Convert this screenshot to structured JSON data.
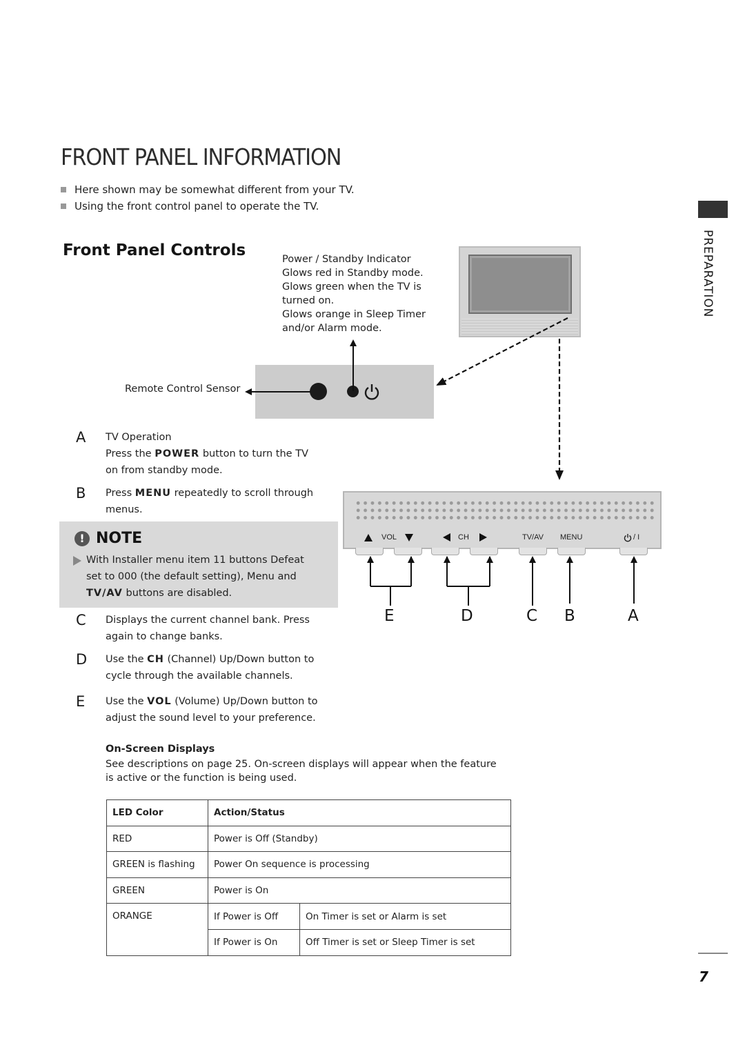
{
  "page": {
    "title": "FRONT PANEL INFORMATION",
    "bullets": [
      "Here shown may be somewhat different from your TV.",
      "Using the front control panel to operate the TV."
    ],
    "side_tab_label": "PREPARATION",
    "page_number": "7"
  },
  "section": {
    "heading": "Front Panel Controls"
  },
  "indicator": {
    "lines": [
      "Power / Standby Indicator",
      "Glows red in Standby mode.",
      "Glows green when the TV is",
      "turned on.",
      "Glows orange in Sleep Timer",
      "and/or Alarm mode."
    ]
  },
  "sensor": {
    "label": "Remote Control Sensor"
  },
  "items": {
    "A": {
      "letter": "A",
      "line1": "TV Operation",
      "line2_pre": "Press the ",
      "line2_kw": "POWER",
      "line2_post": " button to turn the TV",
      "line3": "on from standby mode."
    },
    "B": {
      "letter": "B",
      "line1_pre": "Press ",
      "line1_kw": "MENU",
      "line1_post": " repeatedly to scroll through",
      "line2": "menus."
    },
    "C": {
      "letter": "C",
      "line1": "Displays the current channel bank. Press",
      "line2": "again to change banks."
    },
    "D": {
      "letter": "D",
      "line1_pre": "Use the ",
      "line1_kw": "CH",
      "line1_post": " (Channel) Up/Down button to",
      "line2": "cycle through the available channels."
    },
    "E": {
      "letter": "E",
      "line1_pre": "Use the ",
      "line1_kw": "VOL",
      "line1_post": " (Volume) Up/Down button to",
      "line2": "adjust the sound level to your preference."
    }
  },
  "note": {
    "icon": "!",
    "title": "NOTE",
    "line1": "With Installer menu item 11 buttons Defeat",
    "line2": "set to 000 (the default setting), Menu and",
    "line3_kw": "TV/AV",
    "line3_post": " buttons are disabled."
  },
  "front_panel": {
    "labels": {
      "vol": "VOL",
      "ch": "CH",
      "tvav": "TV/AV",
      "menu": "MENU",
      "power": "/ I"
    },
    "callouts": [
      "E",
      "D",
      "C",
      "B",
      "A"
    ]
  },
  "osd": {
    "title": "On-Screen Displays",
    "line1": "See descriptions on page 25. On-screen displays will appear when the feature",
    "line2": "is active or the function is being used."
  },
  "led_table": {
    "headers": [
      "LED Color",
      "Action/Status"
    ],
    "rows": [
      {
        "color": "RED",
        "status": "Power is Off (Standby)"
      },
      {
        "color": "GREEN is flashing",
        "status": "Power On sequence is processing"
      },
      {
        "color": "GREEN",
        "status": "Power is On"
      }
    ],
    "orange": {
      "color": "ORANGE",
      "sub": [
        {
          "condition": "If Power is Off",
          "status": "On Timer is set or Alarm is set"
        },
        {
          "condition": "If Power is On",
          "status": "Off Timer is set or Sleep Timer is set"
        }
      ]
    }
  }
}
